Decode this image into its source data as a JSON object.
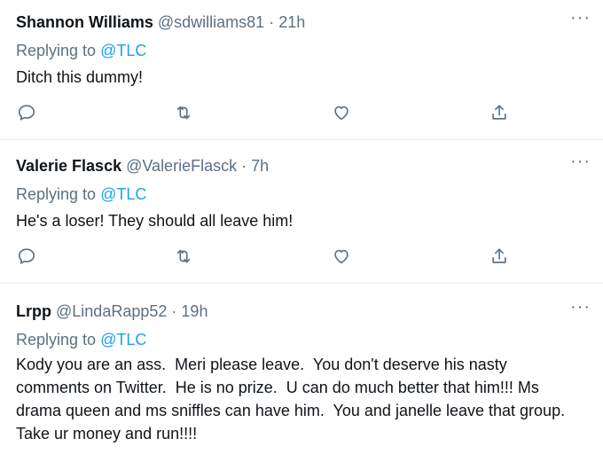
{
  "tweets": [
    {
      "name": "Shannon Williams",
      "handle": "@sdwilliams81",
      "separator": "·",
      "time": "21h",
      "replying_prefix": "Replying to",
      "replying_to": "@TLC",
      "text": "Ditch this dummy!"
    },
    {
      "name": "Valerie Flasck",
      "handle": "@ValerieFlasck",
      "separator": "·",
      "time": "7h",
      "replying_prefix": "Replying to",
      "replying_to": "@TLC",
      "text": "He's a loser! They should all leave him!"
    },
    {
      "name": "Lrpp",
      "handle": "@LindaRapp52",
      "separator": "·",
      "time": "19h",
      "replying_prefix": "Replying to",
      "replying_to": "@TLC",
      "text": "Kody you are an ass.  Meri please leave.  You don't deserve his nasty comments on Twitter.  He is no prize.  U can do much better that him!!! Ms drama queen and ms sniffles can have him.  You and janelle leave that group.  Take ur money and run!!!!"
    }
  ],
  "more_label": "···",
  "icons": {
    "reply": "reply-icon",
    "retweet": "retweet-icon",
    "like": "like-icon",
    "share": "share-icon",
    "more": "more-icon"
  },
  "colors": {
    "name": "#0f1419",
    "muted": "#5b7083",
    "mention": "#1da1f2",
    "divider": "#e6ecf0"
  }
}
